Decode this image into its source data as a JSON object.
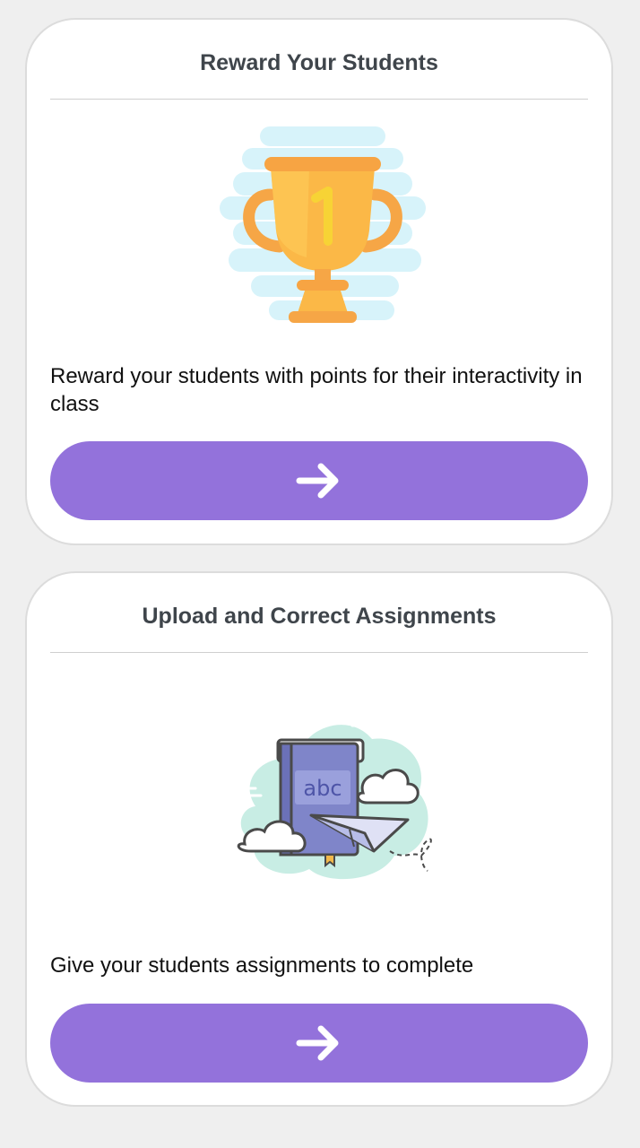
{
  "cards": [
    {
      "title": "Reward Your Students",
      "description": "Reward your students with points for their interactivity in class",
      "illustration": "trophy-icon",
      "button_icon": "arrow-right-icon"
    },
    {
      "title": "Upload and Correct Assignments",
      "description": "Give your students assignments to complete",
      "illustration": "book-paper-plane-icon",
      "button_icon": "arrow-right-icon"
    }
  ],
  "colors": {
    "background": "#efefef",
    "card": "#ffffff",
    "button": "#9372db",
    "title": "#3f454b",
    "text": "#111111"
  }
}
